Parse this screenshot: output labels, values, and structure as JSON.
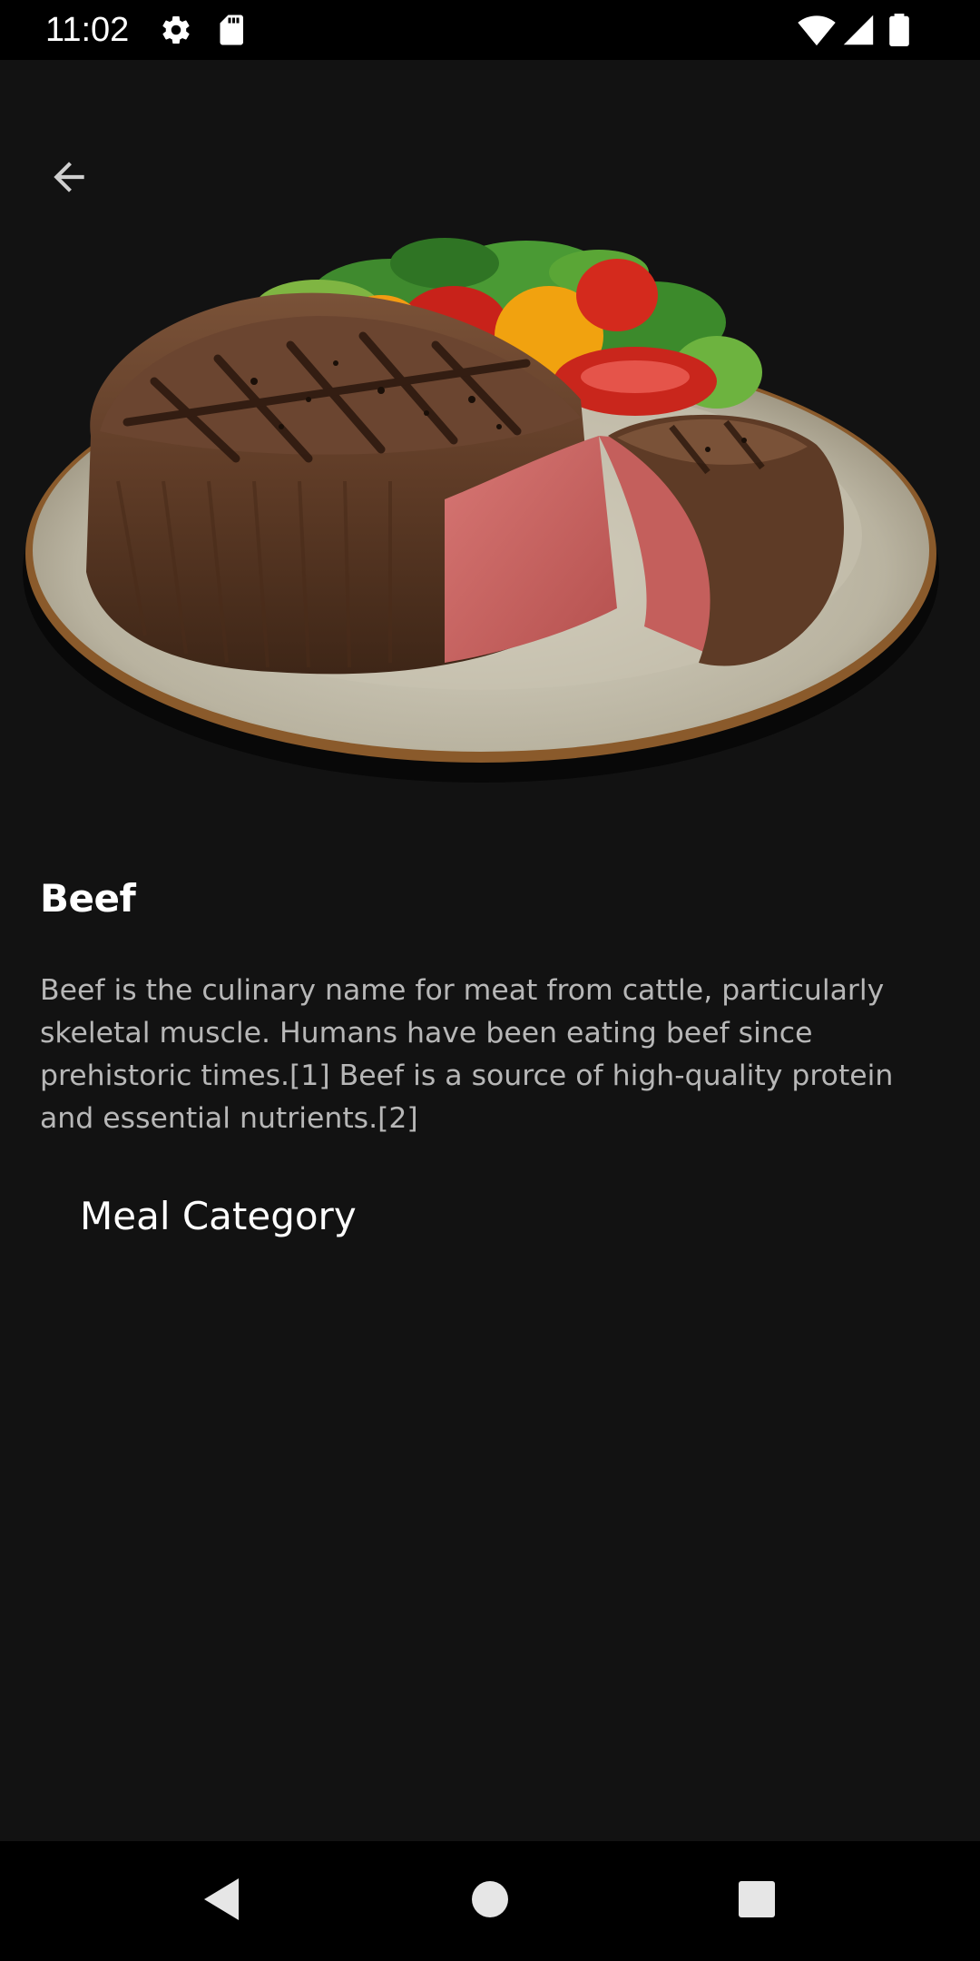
{
  "status_bar": {
    "time": "11:02",
    "left_icons": [
      "gear-icon",
      "sd-card-icon"
    ],
    "right_icons": [
      "wifi-icon",
      "cellular-signal-icon",
      "battery-icon"
    ]
  },
  "toolbar": {
    "back_icon": "arrow-left-icon"
  },
  "hero_image": {
    "subject": "steak-plate-icon"
  },
  "category": {
    "title": "Beef",
    "description": "Beef is the culinary name for meat from cattle, particularly skeletal muscle. Humans have been eating beef since prehistoric times.[1] Beef is a source of high-quality protein and essential nutrients.[2]"
  },
  "section": {
    "heading": "Meal Category"
  },
  "nav_bar": {
    "icons": [
      "nav-back-icon",
      "nav-home-icon",
      "nav-recents-icon"
    ]
  },
  "colors": {
    "background": "#121212",
    "bars": "#000000",
    "title_text": "#ffffff",
    "body_text": "#b7b7b7"
  }
}
